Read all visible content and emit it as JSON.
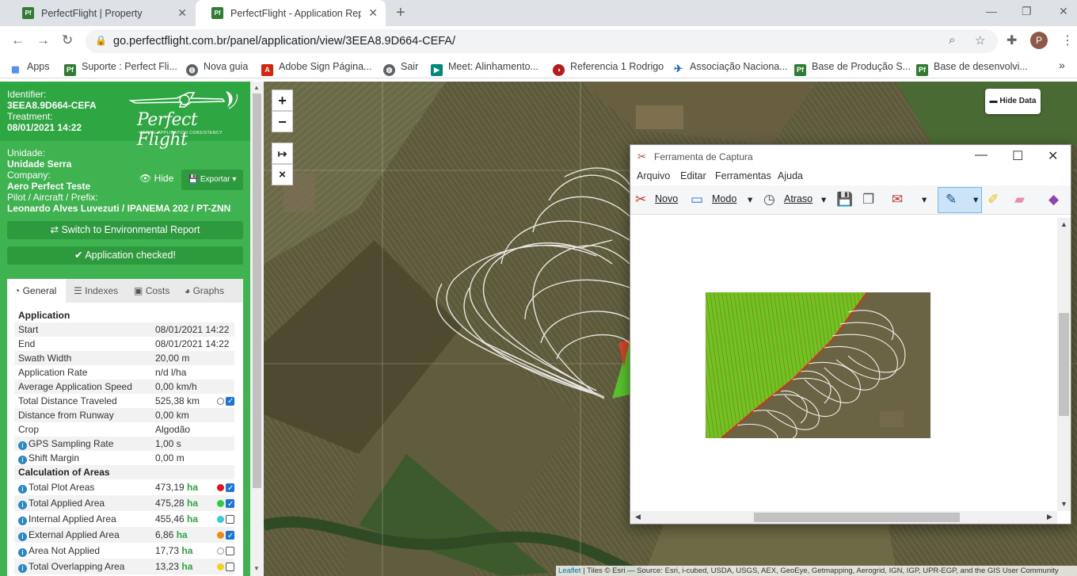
{
  "browser": {
    "tabs": [
      {
        "label": "PerfectFlight | Property",
        "favicon": "Pf",
        "active": false
      },
      {
        "label": "PerfectFlight - Application Repor",
        "favicon": "Pf",
        "active": true
      }
    ],
    "url": "go.perfectflight.com.br/panel/application/view/3EEA8.9D664-CEFA/",
    "profile_initial": "P",
    "bookmarks": [
      {
        "label": "Apps",
        "icon": "apps-grid-icon"
      },
      {
        "label": "Suporte : Perfect Fli...",
        "icon": "pf-icon"
      },
      {
        "label": "Nova guia",
        "icon": "globe-icon"
      },
      {
        "label": "Adobe Sign Página...",
        "icon": "adobe-icon"
      },
      {
        "label": "Sair",
        "icon": "globe-icon"
      },
      {
        "label": "Meet: Alinhamento...",
        "icon": "meet-icon"
      },
      {
        "label": "Referencia 1 Rodrigo",
        "icon": "chart-icon"
      },
      {
        "label": "Associação Naciona...",
        "icon": "plane-icon"
      },
      {
        "label": "Base de Produção S...",
        "icon": "pf-icon"
      },
      {
        "label": "Base de desenvolvi...",
        "icon": "pf-icon"
      }
    ],
    "more_bookmarks": "»"
  },
  "sidebar": {
    "identifier_label": "Identifier:",
    "identifier": "3EEA8.9D664-CEFA",
    "treatment_label": "Treatment:",
    "treatment": "08/01/2021 14:22",
    "logo_text": "Perfect Flight",
    "logo_sub": "AERIAL APPLICATION CONSISTENCY",
    "unidade_label": "Unidade:",
    "unidade": "Unidade Serra",
    "company_label": "Company:",
    "company": "Aero Perfect Teste",
    "pilot_label": "Pilot / Aircraft / Prefix:",
    "pilot": "Leonardo Alves Luvezuti / IPANEMA 202 / PT-ZNN",
    "hide_label": "Hide",
    "export_label": "Exportar",
    "switch_label": "Switch to Environmental Report",
    "checked_label": "Application checked!",
    "tabs": [
      "General",
      "Indexes",
      "Costs",
      "Graphs"
    ],
    "application_heading": "Application",
    "rows": [
      {
        "k": "Start",
        "v": "08/01/2021 14:22"
      },
      {
        "k": "End",
        "v": "08/01/2021 14:22"
      },
      {
        "k": "Swath Width",
        "v": "20,00 m"
      },
      {
        "k": "Application Rate",
        "v": "n/d l/ha"
      },
      {
        "k": "Average Application Speed",
        "v": "0,00 km/h"
      },
      {
        "k": "Total Distance Traveled",
        "v": "525,38 km"
      },
      {
        "k": "Distance from Runway",
        "v": "0,00 km"
      },
      {
        "k": "Crop",
        "v": "Algodão"
      },
      {
        "k": "GPS Sampling Rate",
        "v": "1,00 s"
      },
      {
        "k": "Shift Margin",
        "v": "0,00 m"
      }
    ],
    "areas_heading": "Calculation of Areas",
    "area_unit": "ha",
    "areas": [
      {
        "k": "Total Plot Areas",
        "v": "473,19",
        "color": "#e0141e",
        "checked": true
      },
      {
        "k": "Total Applied Area",
        "v": "475,28",
        "color": "#2ecc40",
        "checked": true
      },
      {
        "k": "Internal Applied Area",
        "v": "455,46",
        "color": "#39c9d9",
        "checked": false
      },
      {
        "k": "External Applied Area",
        "v": "6,86",
        "color": "#ef8a17",
        "checked": true
      },
      {
        "k": "Area Not Applied",
        "v": "17,73",
        "color": "#ffffff",
        "checked": false
      },
      {
        "k": "Total Overlapping Area",
        "v": "13,23",
        "color": "#f2d21b",
        "checked": false
      }
    ]
  },
  "map": {
    "zoom_in": "+",
    "zoom_out": "−",
    "measure": "↦",
    "close": "×",
    "hide_data": "Hide Data",
    "attribution_link": "Leaflet",
    "attribution": " | Tiles © Esri — Source: Esri, i-cubed, USDA, USGS, AEX, GeoEye, Getmapping, Aerogrid, IGN, IGP, UPR-EGP, and the GIS User Community"
  },
  "snipping_tool": {
    "title": "Ferramenta de Captura",
    "menu": [
      "Arquivo",
      "Editar",
      "Ferramentas",
      "Ajuda"
    ],
    "new_label": "Novo",
    "mode_label": "Modo",
    "delay_label": "Atraso"
  }
}
